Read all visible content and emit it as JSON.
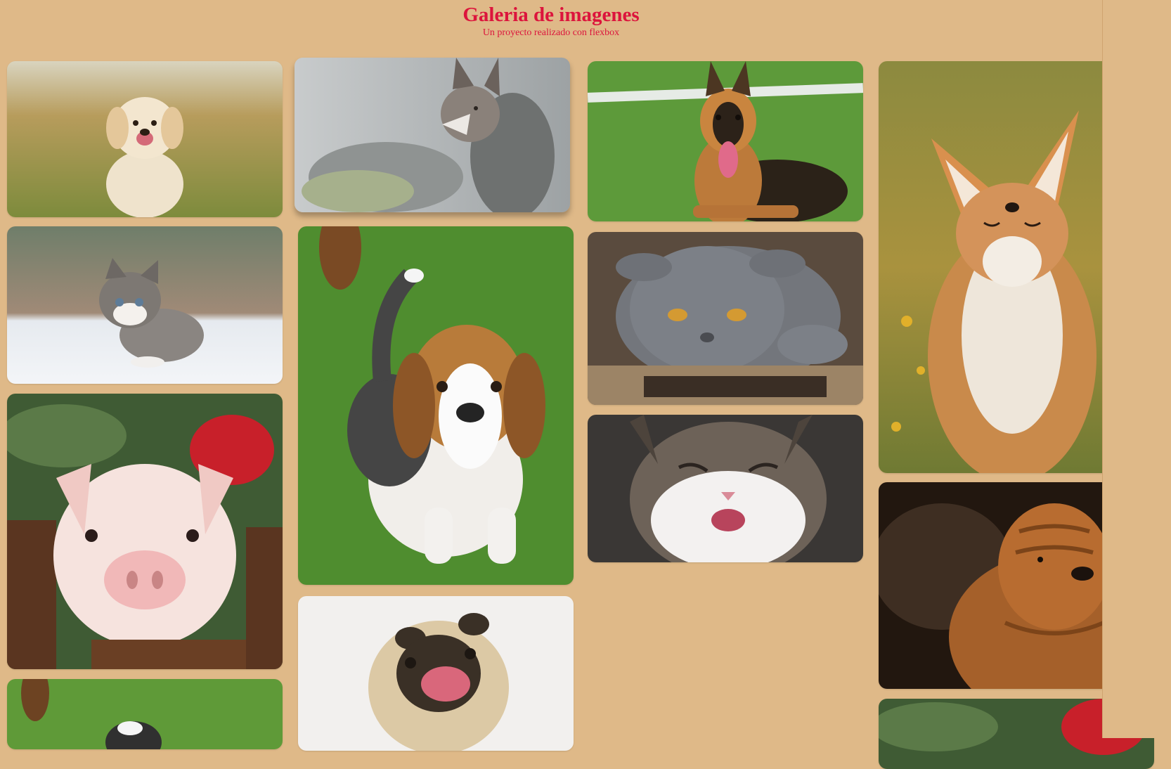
{
  "header": {
    "title": "Galeria de imagenes",
    "subtitle": "Un proyecto realizado con flexbox"
  },
  "gallery": {
    "images": [
      {
        "name": "golden-puppy"
      },
      {
        "name": "kitten"
      },
      {
        "name": "piglet"
      },
      {
        "name": "beagle-puppy-repeat"
      },
      {
        "name": "grey-fox"
      },
      {
        "name": "beagle-puppy"
      },
      {
        "name": "pug"
      },
      {
        "name": "german-shepherd"
      },
      {
        "name": "grey-cat"
      },
      {
        "name": "laughing-cat"
      },
      {
        "name": "red-fox"
      },
      {
        "name": "shar-pei"
      },
      {
        "name": "piglet-repeat"
      }
    ]
  },
  "colors": {
    "background": "#dfb988",
    "accent": "#dc143c"
  }
}
